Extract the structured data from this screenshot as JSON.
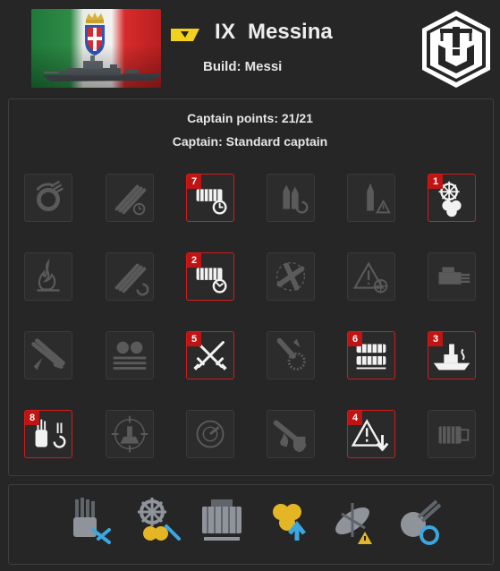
{
  "ship": {
    "tier": "IX",
    "name": "Messina",
    "build_label": "Build: Messi"
  },
  "captain": {
    "points_label": "Captain points: 21/21",
    "captain_label": "Captain: Standard captain"
  },
  "skills": [
    {
      "name": "grease-the-gears-icon",
      "order": ""
    },
    {
      "name": "main-battery-reload-icon",
      "order": ""
    },
    {
      "name": "torpedo-reload-timer-icon",
      "order": "7"
    },
    {
      "name": "he-shell-reload-icon",
      "order": ""
    },
    {
      "name": "shell-warning-icon",
      "order": ""
    },
    {
      "name": "propulsion-steering-icon",
      "order": "1"
    },
    {
      "name": "fire-icon",
      "order": ""
    },
    {
      "name": "gun-barrels-reload-icon",
      "order": ""
    },
    {
      "name": "torpedo-clock-icon",
      "order": "2"
    },
    {
      "name": "fighter-plane-icon",
      "order": ""
    },
    {
      "name": "incoming-fire-alert-icon",
      "order": ""
    },
    {
      "name": "secondary-battery-icon",
      "order": ""
    },
    {
      "name": "burning-aa-icon",
      "order": ""
    },
    {
      "name": "turret-stack-icon",
      "order": ""
    },
    {
      "name": "crossed-swords-icon",
      "order": "5"
    },
    {
      "name": "aa-burst-icon",
      "order": ""
    },
    {
      "name": "torpedo-armament-icon",
      "order": "6"
    },
    {
      "name": "battleship-fire-icon",
      "order": "3"
    },
    {
      "name": "hydro-reload-icon",
      "order": "8"
    },
    {
      "name": "ship-target-icon",
      "order": ""
    },
    {
      "name": "radar-icon",
      "order": ""
    },
    {
      "name": "fire-shield-icon",
      "order": ""
    },
    {
      "name": "alert-down-icon",
      "order": "4"
    },
    {
      "name": "engine-block-icon",
      "order": ""
    }
  ],
  "modules": [
    {
      "name": "main-armament-mod-icon"
    },
    {
      "name": "steering-gear-mod-icon"
    },
    {
      "name": "engine-room-mod-icon"
    },
    {
      "name": "propulsion-boost-mod-icon"
    },
    {
      "name": "aircraft-warning-mod-icon"
    },
    {
      "name": "secondary-turret-mod-icon"
    }
  ],
  "colors": {
    "selected_border": "#d21c1c",
    "badge": "#c01414",
    "tier_badge": "#f2d21f",
    "background": "#262626"
  }
}
